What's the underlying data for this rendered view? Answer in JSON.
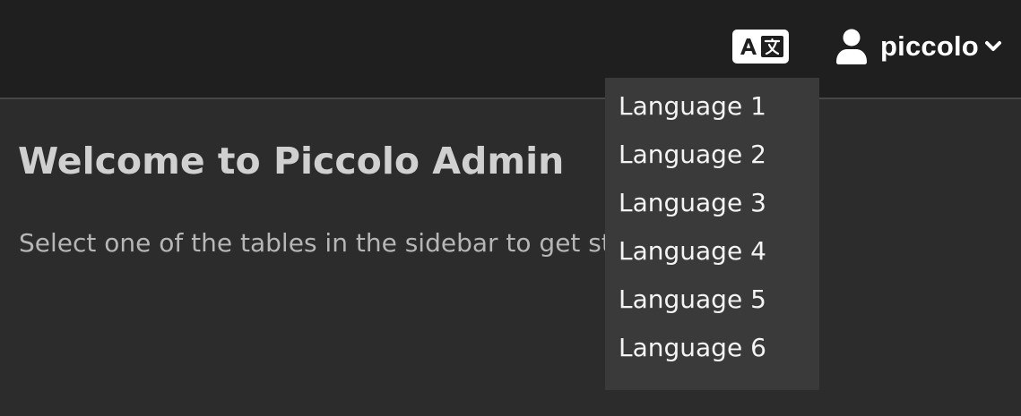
{
  "header": {
    "translate_icon": "translate-icon",
    "user": {
      "icon": "user-icon",
      "name": "piccolo",
      "dropdown_icon": "chevron-down-icon"
    }
  },
  "main": {
    "title": "Welcome to Piccolo Admin",
    "subtitle": "Select one of the tables in the sidebar to get started."
  },
  "language_menu": {
    "items": [
      {
        "label": "Language 1"
      },
      {
        "label": "Language 2"
      },
      {
        "label": "Language 3"
      },
      {
        "label": "Language 4"
      },
      {
        "label": "Language 5"
      },
      {
        "label": "Language 6"
      }
    ]
  },
  "colors": {
    "topbar_bg": "#1f1f1f",
    "main_bg": "#2c2c2c",
    "dropdown_bg": "#3a3a3a",
    "title_text": "#d0d0d0",
    "subtitle_text": "#b6b6b6"
  }
}
